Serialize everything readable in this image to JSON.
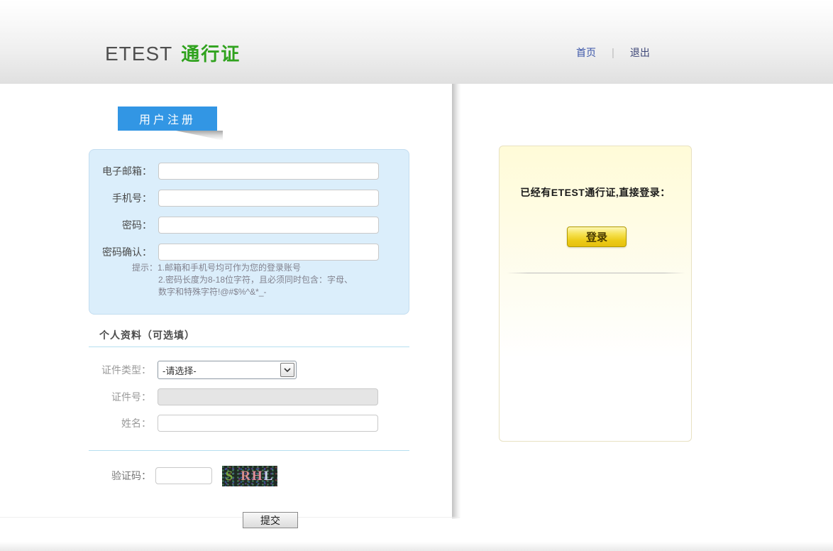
{
  "colors": {
    "brand_green": "#2fa21d",
    "tab_blue": "#3296e4",
    "link_blue": "#3a55a8",
    "panel_blue_bg": "#dbeefb",
    "panel_blue_border": "#c3ddf0",
    "divider_blue": "#b5dff0",
    "login_panel_bg": "#fffbd8",
    "login_button_gold": "#e6c00e"
  },
  "header": {
    "logo_etest": "ETEST",
    "logo_cn": "通行证",
    "nav_home": "首页",
    "nav_separator": "|",
    "nav_logout": "退出"
  },
  "register": {
    "tab_label": "用户注册",
    "fields": [
      {
        "name": "email",
        "label": "电子邮箱：",
        "value": ""
      },
      {
        "name": "phone",
        "label": "手机号：",
        "value": ""
      },
      {
        "name": "password",
        "label": "密码：",
        "value": ""
      },
      {
        "name": "password_confirm",
        "label": "密码确认：",
        "value": ""
      }
    ],
    "hints": [
      "提示：1.邮箱和手机号均可作为您的登录账号",
      "2.密码长度为8-18位字符，且必须同时包含：字母、",
      "数字和特殊字符!@#$%^&*_-"
    ],
    "profile_title": "个人资料（可选填）",
    "id_type_label": "证件类型：",
    "id_type_value": "-请选择-",
    "id_number_label": "证件号：",
    "id_number_value": "",
    "name_label": "姓名：",
    "name_value": "",
    "captcha_label": "验证码：",
    "captcha_value": "",
    "captcha_letters": [
      {
        "char": "S",
        "color": "#79a73e"
      },
      {
        "char": "R",
        "color": "#d78f8f"
      },
      {
        "char": "H",
        "color": "#e08e9b"
      },
      {
        "char": "L",
        "color": "#ccd4e8"
      }
    ],
    "submit_label": "提交"
  },
  "login_panel": {
    "prompt": "已经有ETEST通行证,直接登录：",
    "login_label": "登录"
  }
}
